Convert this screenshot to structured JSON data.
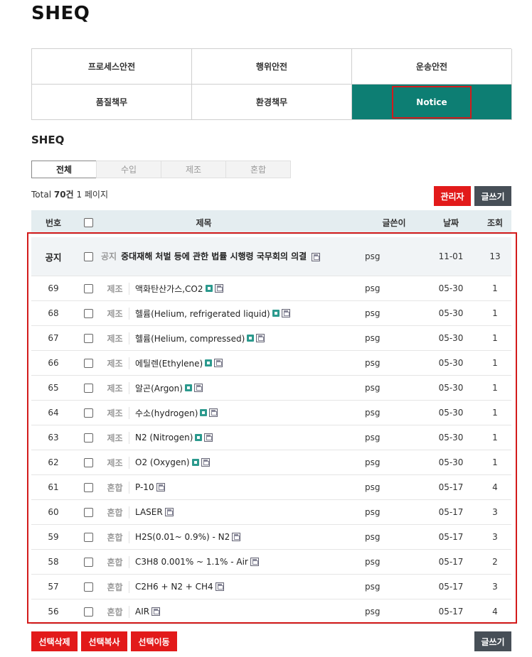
{
  "page_title": "SHEQ",
  "categories": [
    {
      "label": "프로세스안전"
    },
    {
      "label": "행위안전"
    },
    {
      "label": "운송안전"
    },
    {
      "label": "품질책무"
    },
    {
      "label": "환경책무"
    },
    {
      "label": "Notice"
    }
  ],
  "section_title": "SHEQ",
  "filter_tabs": [
    "전체",
    "수입",
    "제조",
    "혼합"
  ],
  "total": {
    "prefix": "Total",
    "count": "70건",
    "pages": "1 페이지"
  },
  "buttons": {
    "admin": "관리자",
    "write": "글쓰기",
    "delete_selected": "선택삭제",
    "copy_selected": "선택복사",
    "move_selected": "선택이동"
  },
  "columns": {
    "num": "번호",
    "title": "제목",
    "writer": "글쓴이",
    "date": "날짜",
    "views": "조회"
  },
  "notice_row": {
    "num": "공지",
    "category": "공지",
    "title": "중대재해 처벌 등에 관한 법률 시행령 국무회의 의결",
    "writer": "psg",
    "date": "11-01",
    "views": "13"
  },
  "rows": [
    {
      "num": "69",
      "category": "제조",
      "title": "액화탄산가스,CO2",
      "comment_icon": true,
      "writer": "psg",
      "date": "05-30",
      "views": "1"
    },
    {
      "num": "68",
      "category": "제조",
      "title": "헬륨(Helium, refrigerated liquid)",
      "comment_icon": true,
      "writer": "psg",
      "date": "05-30",
      "views": "1"
    },
    {
      "num": "67",
      "category": "제조",
      "title": "헬륨(Helium, compressed)",
      "comment_icon": true,
      "writer": "psg",
      "date": "05-30",
      "views": "1"
    },
    {
      "num": "66",
      "category": "제조",
      "title": "에틸렌(Ethylene)",
      "comment_icon": true,
      "writer": "psg",
      "date": "05-30",
      "views": "1"
    },
    {
      "num": "65",
      "category": "제조",
      "title": "알곤(Argon)",
      "comment_icon": true,
      "writer": "psg",
      "date": "05-30",
      "views": "1"
    },
    {
      "num": "64",
      "category": "제조",
      "title": "수소(hydrogen)",
      "comment_icon": true,
      "writer": "psg",
      "date": "05-30",
      "views": "1"
    },
    {
      "num": "63",
      "category": "제조",
      "title": "N2 (Nitrogen)",
      "comment_icon": true,
      "writer": "psg",
      "date": "05-30",
      "views": "1"
    },
    {
      "num": "62",
      "category": "제조",
      "title": "O2 (Oxygen)",
      "comment_icon": true,
      "writer": "psg",
      "date": "05-30",
      "views": "1"
    },
    {
      "num": "61",
      "category": "혼합",
      "title": "P-10",
      "comment_icon": false,
      "writer": "psg",
      "date": "05-17",
      "views": "4"
    },
    {
      "num": "60",
      "category": "혼합",
      "title": "LASER",
      "comment_icon": false,
      "writer": "psg",
      "date": "05-17",
      "views": "3"
    },
    {
      "num": "59",
      "category": "혼합",
      "title": "H2S(0.01~ 0.9%) - N2",
      "comment_icon": false,
      "writer": "psg",
      "date": "05-17",
      "views": "3"
    },
    {
      "num": "58",
      "category": "혼합",
      "title": "C3H8 0.001% ~ 1.1% - Air",
      "comment_icon": false,
      "writer": "psg",
      "date": "05-17",
      "views": "2"
    },
    {
      "num": "57",
      "category": "혼합",
      "title": "C2H6 + N2 + CH4",
      "comment_icon": false,
      "writer": "psg",
      "date": "05-17",
      "views": "3"
    },
    {
      "num": "56",
      "category": "혼합",
      "title": "AIR",
      "comment_icon": false,
      "writer": "psg",
      "date": "05-17",
      "views": "4"
    }
  ],
  "colors": {
    "accent_teal": "#0d7e73",
    "action_red": "#e21a1a",
    "dark_button": "#474f57",
    "highlight_frame": "#d31b1b",
    "header_bg": "#e4edf0"
  }
}
